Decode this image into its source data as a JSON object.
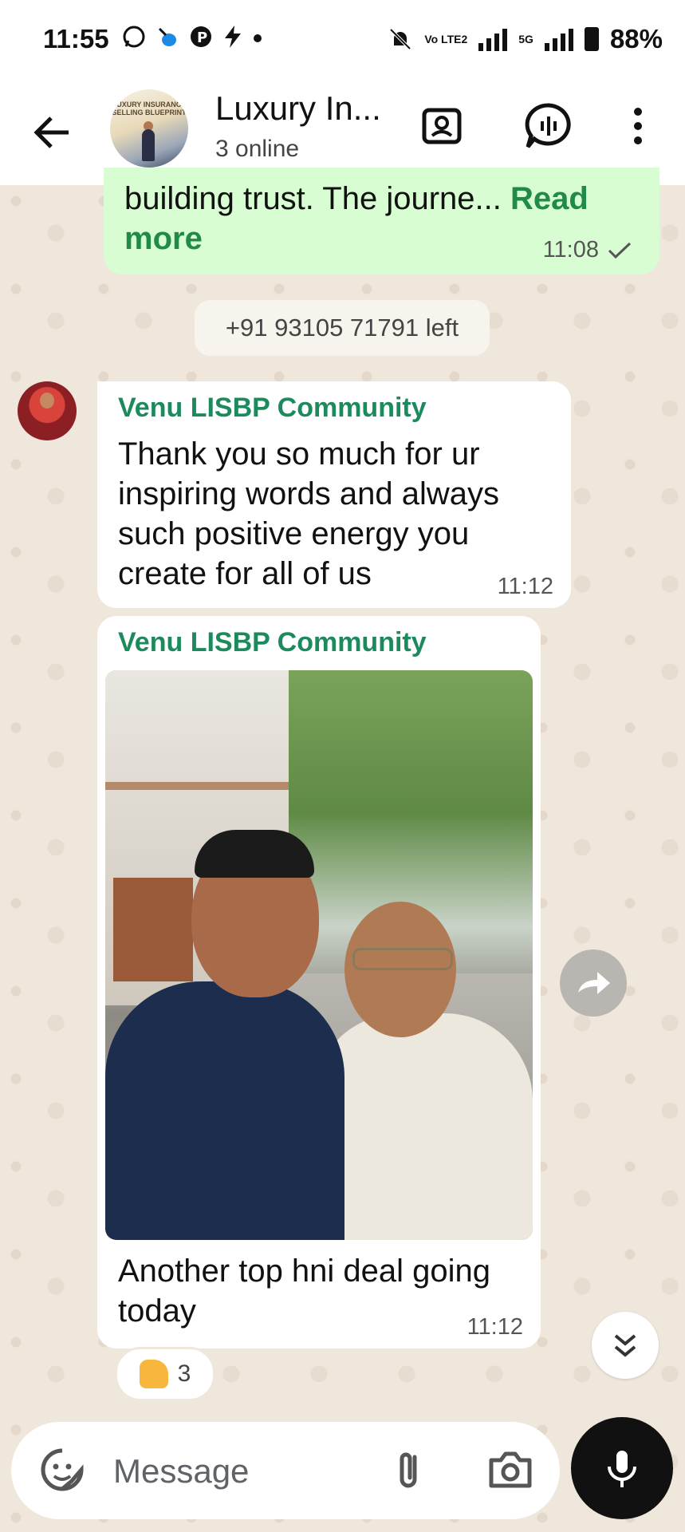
{
  "status_bar": {
    "time": "11:55",
    "network_label": "Vo LTE2",
    "network_5g": "5G",
    "battery": "88%"
  },
  "header": {
    "avatar_text": "LUXURY INSURANCE SELLING BLUEPRINT",
    "title": "Luxury In...",
    "subtitle": "3 online"
  },
  "messages": {
    "outgoing": {
      "text": "building trust. The journe...",
      "read_more": "Read more",
      "time": "11:08"
    },
    "system": "+91 93105 71791 left",
    "incoming_1": {
      "sender": "Venu LISBP Community",
      "text_lines": [
        "Thank you so much for ur",
        "inspiring words and always",
        "such positive energy you",
        "create for all of us"
      ],
      "time": "11:12"
    },
    "incoming_2": {
      "sender": "Venu LISBP Community",
      "caption_lines": [
        "Another top hni deal going",
        "today"
      ],
      "time": "11:12",
      "reaction_count": "3"
    }
  },
  "composer": {
    "placeholder": "Message"
  },
  "colors": {
    "accent": "#1c8a5c",
    "outgoing_bubble": "#d9fdd3",
    "chat_bg": "#efe7dc"
  },
  "icons": [
    "back-arrow-icon",
    "video-call-icon",
    "voice-chat-icon",
    "more-vert-icon",
    "double-check-icon",
    "forward-icon",
    "scroll-down-icon",
    "sticker-icon",
    "attach-icon",
    "camera-icon",
    "mic-icon"
  ]
}
